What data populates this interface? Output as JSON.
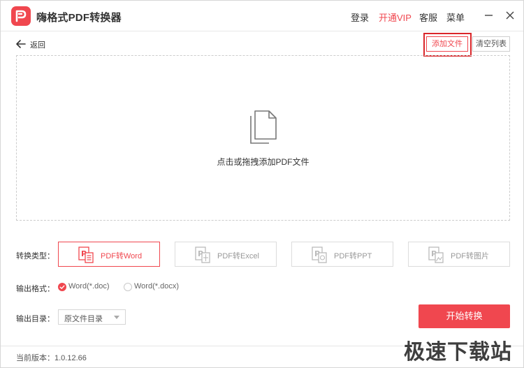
{
  "app": {
    "title": "嗨格式PDF转换器",
    "accent": "#f0474f",
    "logo_icon": "pdf-logo-icon"
  },
  "nav": {
    "login": "登录",
    "vip": "开通VIP",
    "service": "客服",
    "menu": "菜单"
  },
  "toolbar": {
    "back_label": "返回",
    "add_file": "添加文件",
    "clear_list": "清空列表"
  },
  "dropzone": {
    "hint": "点击或拖拽添加PDF文件",
    "icon": "document-stack-icon"
  },
  "conversion": {
    "label": "转换类型：",
    "options": [
      {
        "label": "PDF转Word",
        "active": true,
        "icon": "word-file-icon"
      },
      {
        "label": "PDF转Excel",
        "active": false,
        "icon": "excel-file-icon"
      },
      {
        "label": "PDF转PPT",
        "active": false,
        "icon": "ppt-file-icon"
      },
      {
        "label": "PDF转图片",
        "active": false,
        "icon": "image-file-icon"
      }
    ]
  },
  "format": {
    "label": "输出格式：",
    "options": [
      {
        "label": "Word(*.doc)",
        "checked": true
      },
      {
        "label": "Word(*.docx)",
        "checked": false
      }
    ]
  },
  "output": {
    "label": "输出目录：",
    "selected": "原文件目录"
  },
  "actions": {
    "start": "开始转换"
  },
  "footer": {
    "version": "当前版本：1.0.12.66",
    "watermark": "极速下载站"
  }
}
